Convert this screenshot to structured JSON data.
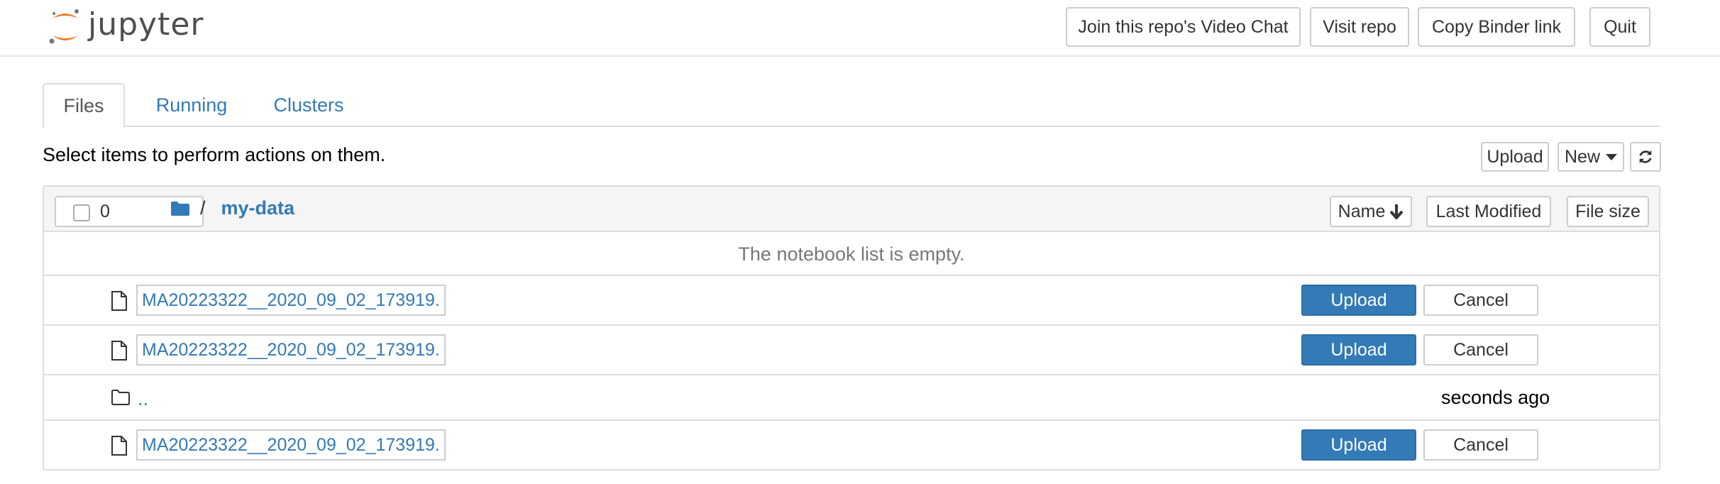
{
  "header": {
    "logo_text": "jupyter",
    "buttons": {
      "video_chat": "Join this repo's Video Chat",
      "visit_repo": "Visit repo",
      "copy_binder": "Copy Binder link",
      "quit": "Quit"
    }
  },
  "tabs": [
    {
      "label": "Files",
      "active": true
    },
    {
      "label": "Running",
      "active": false
    },
    {
      "label": "Clusters",
      "active": false
    }
  ],
  "instructions": "Select items to perform actions on them.",
  "toolbar": {
    "upload": "Upload",
    "new": "New",
    "refresh_icon": "refresh-icon"
  },
  "list_header": {
    "selected_count": "0",
    "breadcrumb_sep": "/",
    "current_dir": "my-data",
    "sort_name": "Name",
    "sort_modified": "Last Modified",
    "sort_size": "File size"
  },
  "empty_message": "The notebook list is empty.",
  "pending_uploads": [
    {
      "filename": "MA20223322__2020_09_02_173919.",
      "upload_label": "Upload",
      "cancel_label": "Cancel"
    },
    {
      "filename": "MA20223322__2020_09_02_173919.",
      "upload_label": "Upload",
      "cancel_label": "Cancel"
    },
    {
      "filename": "MA20223322__2020_09_02_173919.",
      "upload_label": "Upload",
      "cancel_label": "Cancel"
    }
  ],
  "parent_row": {
    "name": "..",
    "modified": "seconds ago"
  },
  "colors": {
    "link": "#337ab7",
    "primary_button": "#337ab7",
    "logo_orange": "#f37726"
  }
}
